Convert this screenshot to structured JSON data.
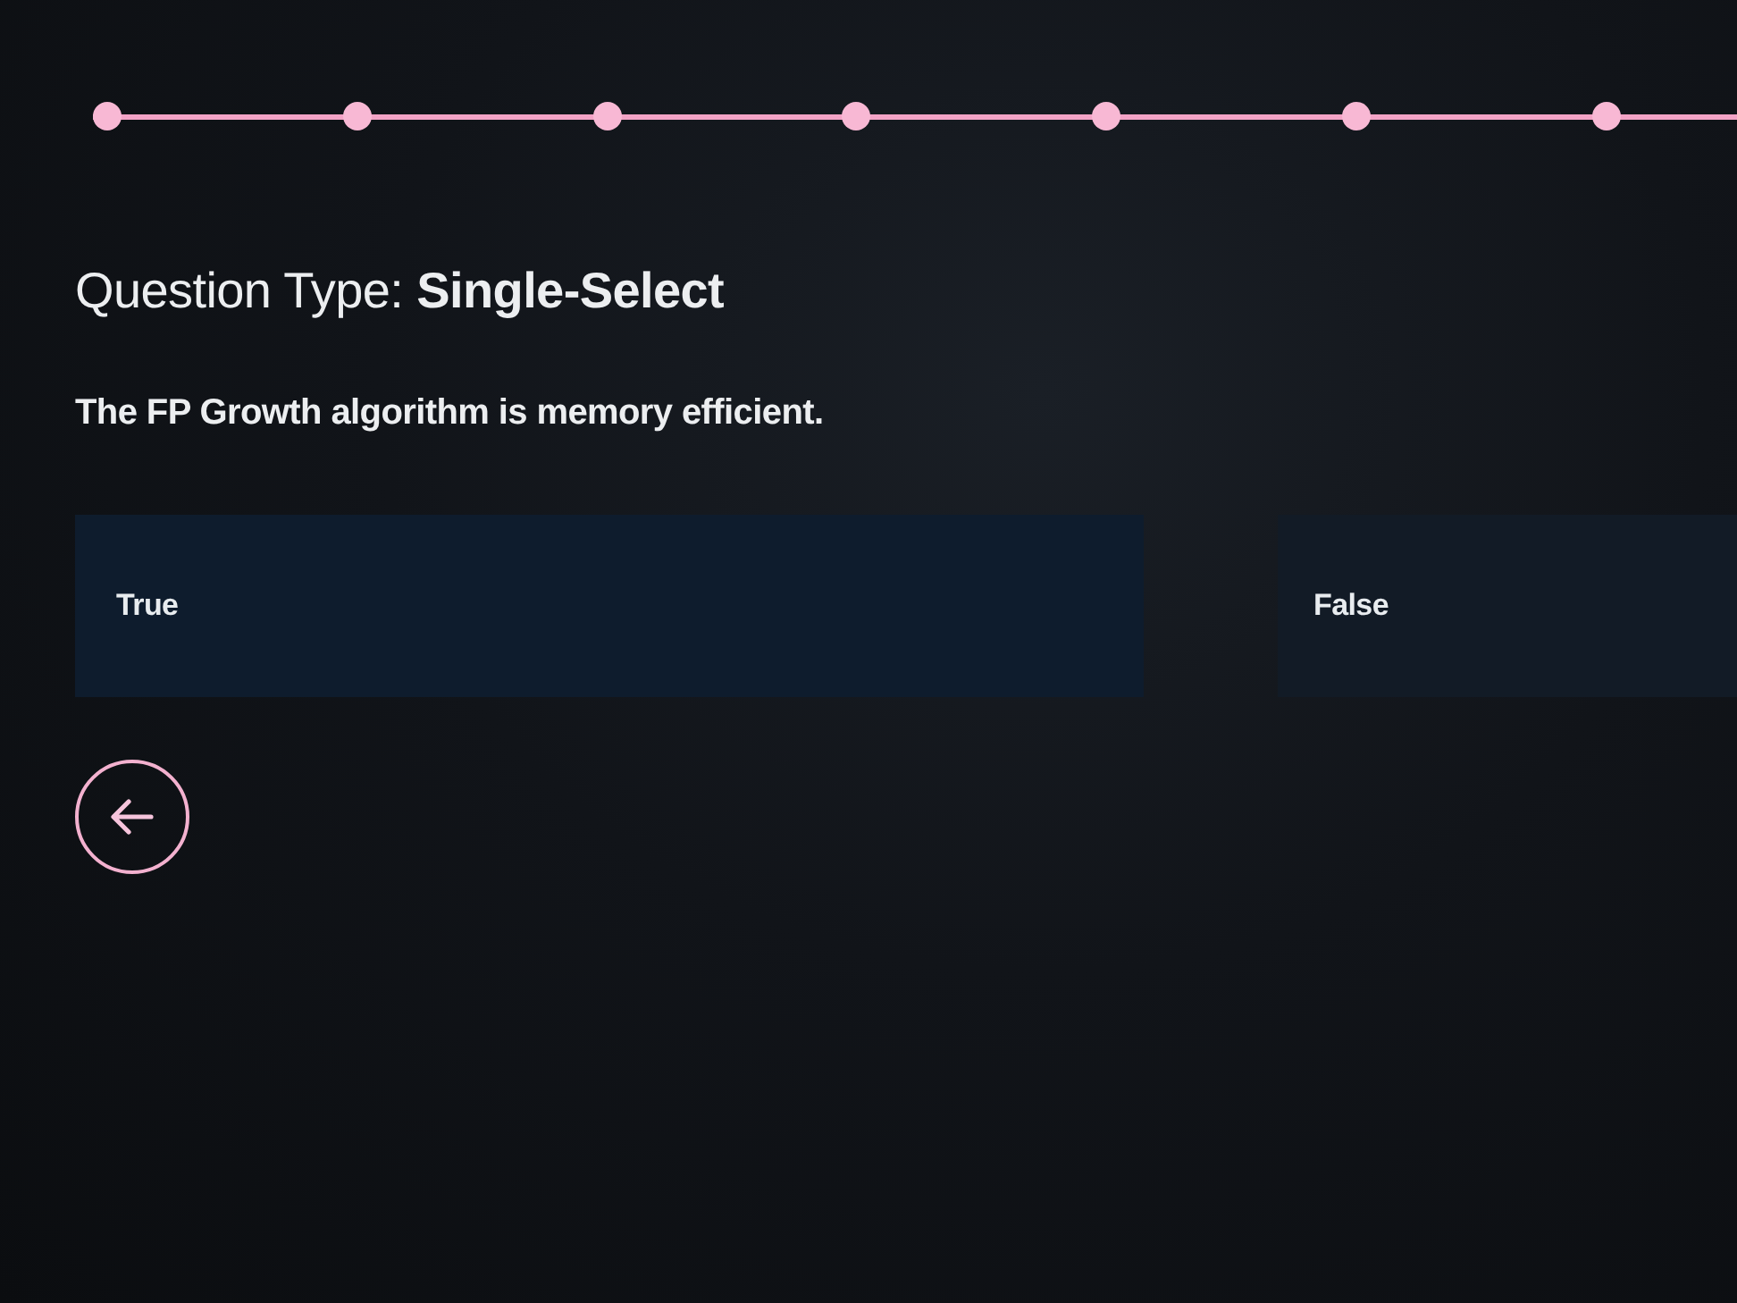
{
  "progress": {
    "steps": [
      {
        "reached": true
      },
      {
        "reached": true
      },
      {
        "reached": true
      },
      {
        "reached": true
      },
      {
        "reached": true
      },
      {
        "reached": true
      },
      {
        "reached": true
      }
    ]
  },
  "question": {
    "type_label": "Question Type: **Single-Select**",
    "text": "The FP Growth algorithm is memory efficient."
  },
  "options": [
    {
      "label": "True",
      "selected": false
    },
    {
      "label": "False",
      "selected": false
    }
  ]
}
